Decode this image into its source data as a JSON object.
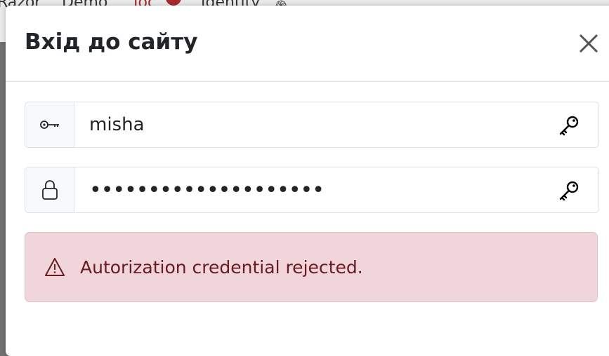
{
  "background_nav": {
    "items": [
      "Razor",
      "Demo",
      "Ioc",
      "Identity"
    ]
  },
  "modal": {
    "title": "Вхід до сайту",
    "close_icon": "close-icon"
  },
  "username_field": {
    "value": "misha",
    "addon_icon": "key-icon",
    "trailing_icon": "key-icon"
  },
  "password_field": {
    "value": "••••••••••••••••••••",
    "addon_icon": "lock-icon",
    "trailing_icon": "key-icon"
  },
  "alert": {
    "icon": "warning-icon",
    "message": "Autorization credential rejected.",
    "color": "#6a1a21",
    "background": "#f0d6da"
  }
}
